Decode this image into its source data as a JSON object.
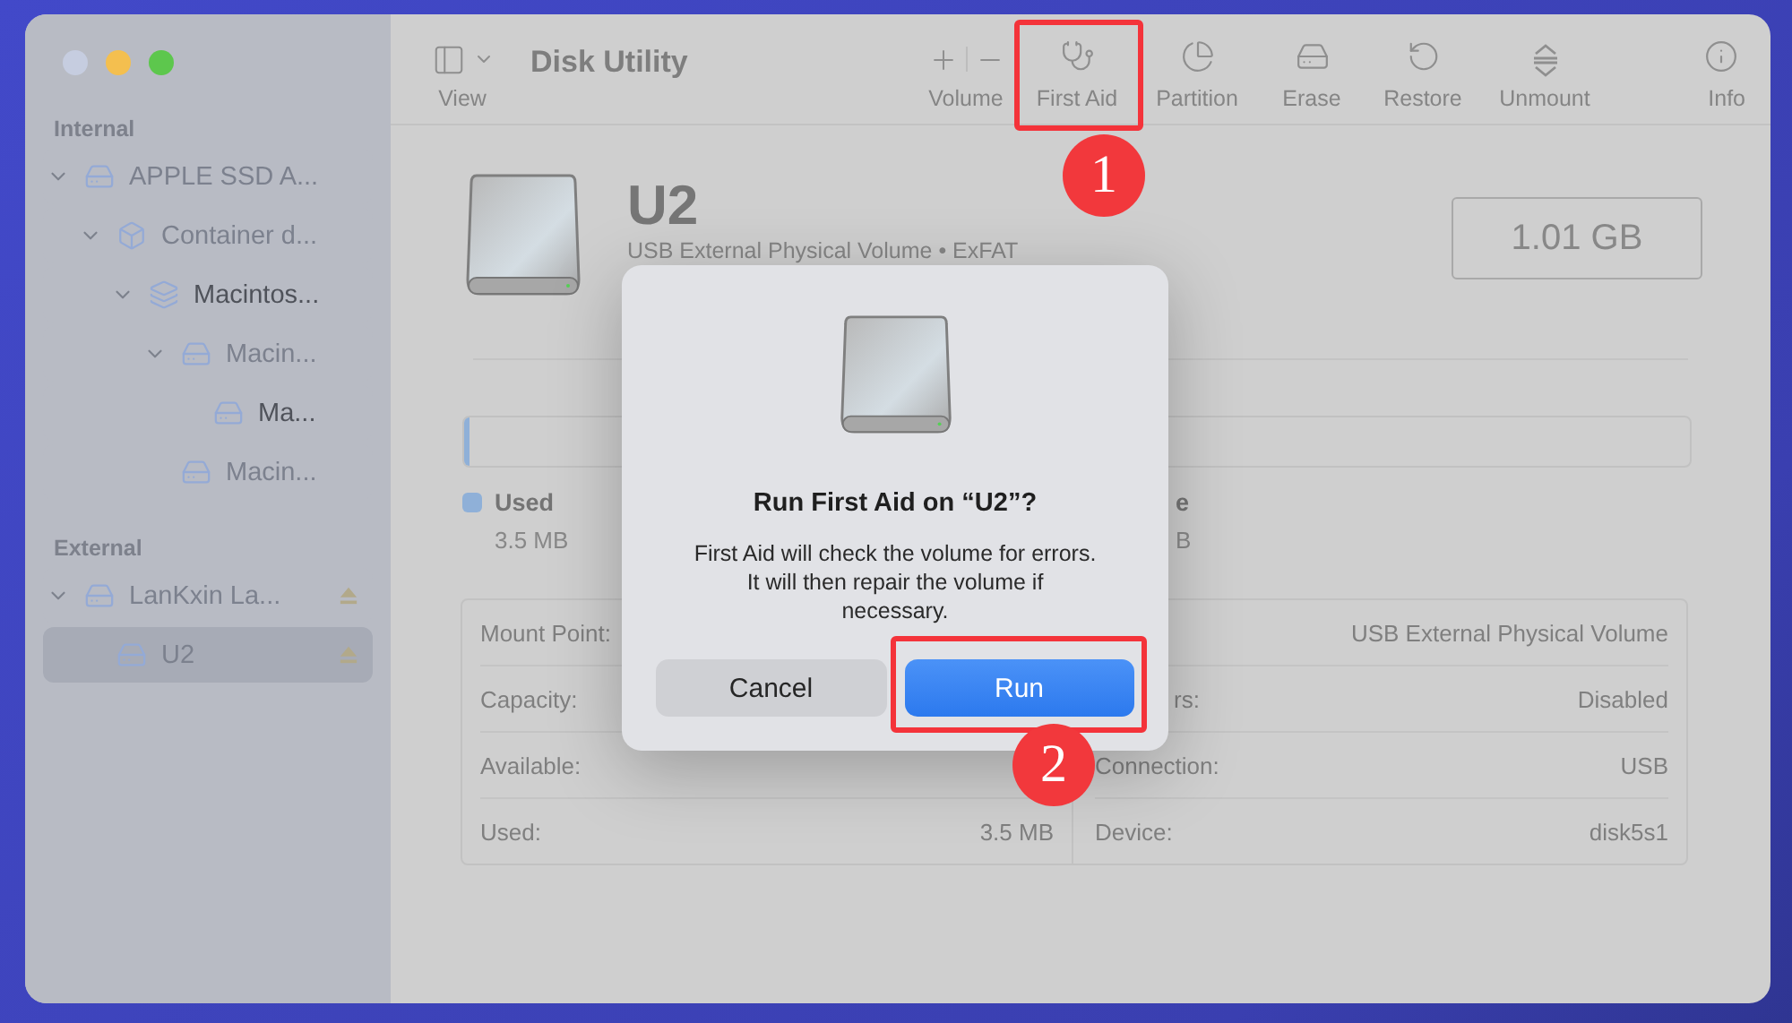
{
  "window": {
    "title": "Disk Utility"
  },
  "toolbar": {
    "view": {
      "label": "View"
    },
    "volume": {
      "label": "Volume"
    },
    "buttons": [
      {
        "kind": "firstaid",
        "label": "First Aid"
      },
      {
        "kind": "partition",
        "label": "Partition"
      },
      {
        "kind": "erase",
        "label": "Erase"
      },
      {
        "kind": "restore",
        "label": "Restore"
      },
      {
        "kind": "unmount",
        "label": "Unmount"
      },
      {
        "kind": "info",
        "label": "Info"
      }
    ]
  },
  "sidebar": {
    "sections": [
      {
        "title": "Internal",
        "items": [
          {
            "label": "APPLE SSD A...",
            "kind": "drive",
            "expanded": true,
            "dimmed": true,
            "selected": false,
            "ejectable": false,
            "children": [
              {
                "label": "Container d...",
                "kind": "container",
                "expanded": true,
                "dimmed": true,
                "selected": false,
                "ejectable": false,
                "children": [
                  {
                    "label": "Macintos...",
                    "kind": "layers",
                    "expanded": true,
                    "dimmed": false,
                    "selected": false,
                    "ejectable": false,
                    "children": [
                      {
                        "label": "Macin...",
                        "kind": "drive",
                        "expanded": true,
                        "dimmed": true,
                        "selected": false,
                        "ejectable": false,
                        "children": [
                          {
                            "label": "Ma...",
                            "kind": "drive",
                            "dimmed": false,
                            "selected": false,
                            "ejectable": false
                          }
                        ]
                      },
                      {
                        "label": "Macin...",
                        "kind": "drive",
                        "dimmed": true,
                        "selected": false,
                        "ejectable": false
                      }
                    ]
                  }
                ]
              }
            ]
          }
        ]
      },
      {
        "title": "External",
        "items": [
          {
            "label": "LanKxin La...",
            "kind": "drive",
            "expanded": true,
            "dimmed": true,
            "selected": false,
            "ejectable": true,
            "children": [
              {
                "label": "U2",
                "kind": "drive",
                "dimmed": true,
                "selected": true,
                "ejectable": true
              }
            ]
          }
        ]
      }
    ]
  },
  "volume": {
    "name": "U2",
    "subtitle": "USB External Physical Volume • ExFAT",
    "size": "1.01 GB"
  },
  "usage": {
    "level": 0.004,
    "legend": [
      {
        "label": "Used",
        "value": "3.5 MB",
        "color": "#8fb0d8"
      },
      {
        "label": "e",
        "value": "B"
      }
    ]
  },
  "info_table": {
    "left": [
      {
        "label": "Mount Point:"
      },
      {
        "label": "Capacity:"
      },
      {
        "label": "Available:"
      },
      {
        "label": "Used:",
        "value": "3.5 MB"
      }
    ],
    "right": [
      {
        "value": "USB External Physical Volume"
      },
      {
        "label": "rs:",
        "value": "Disabled",
        "clipped": true
      },
      {
        "label": "Connection:",
        "value": "USB"
      },
      {
        "label": "Device:",
        "value": "disk5s1"
      }
    ]
  },
  "dialog": {
    "title": "Run First Aid on “U2”?",
    "message_lines": [
      "First Aid will check the volume for errors.",
      "It will then repair the volume if",
      "necessary."
    ],
    "buttons": [
      {
        "label": "Cancel",
        "default": false
      },
      {
        "label": "Run",
        "default": true
      }
    ]
  },
  "annotations": [
    {
      "number": "1"
    },
    {
      "number": "2"
    }
  ]
}
